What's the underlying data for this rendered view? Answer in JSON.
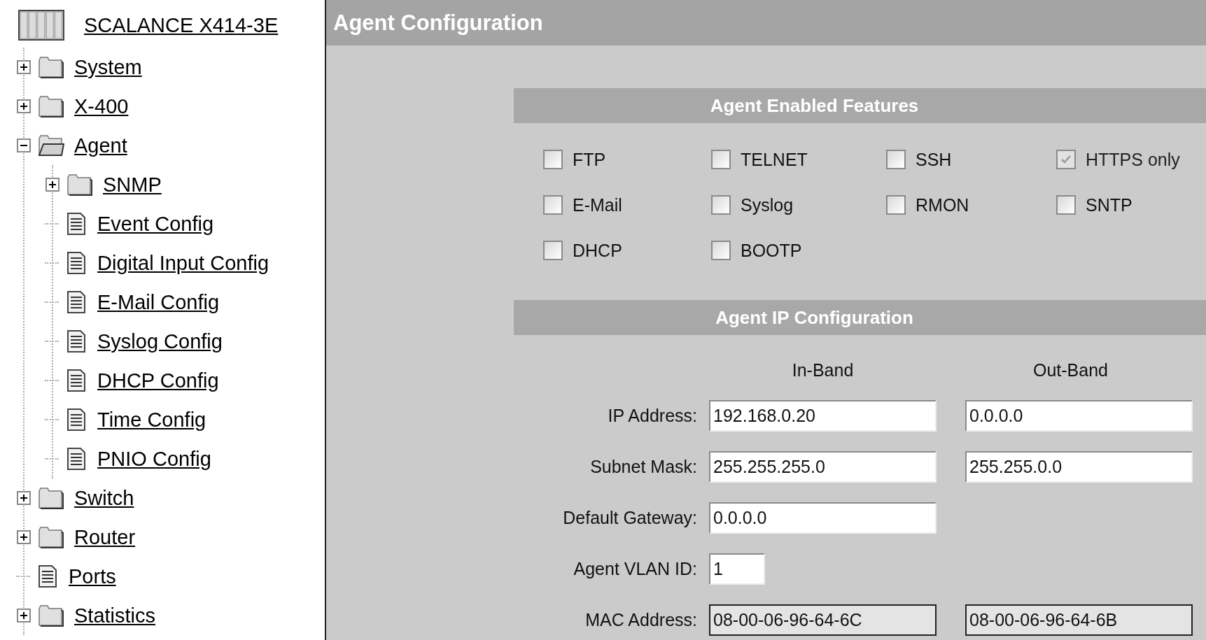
{
  "tree": {
    "root": {
      "label": "SCALANCE X414-3E",
      "kind": "device"
    },
    "items": [
      {
        "label": "System",
        "kind": "folder",
        "expanded": false
      },
      {
        "label": "X-400",
        "kind": "folder",
        "expanded": false
      },
      {
        "label": "Agent",
        "kind": "folder",
        "expanded": true,
        "children": [
          {
            "label": "SNMP",
            "kind": "folder",
            "expanded": false
          },
          {
            "label": "Event Config",
            "kind": "page"
          },
          {
            "label": "Digital Input Config",
            "kind": "page"
          },
          {
            "label": "E-Mail Config",
            "kind": "page"
          },
          {
            "label": "Syslog Config",
            "kind": "page"
          },
          {
            "label": "DHCP Config",
            "kind": "page"
          },
          {
            "label": "Time Config",
            "kind": "page"
          },
          {
            "label": "PNIO Config",
            "kind": "page"
          }
        ]
      },
      {
        "label": "Switch",
        "kind": "folder",
        "expanded": false
      },
      {
        "label": "Router",
        "kind": "folder",
        "expanded": false
      },
      {
        "label": "Ports",
        "kind": "page"
      },
      {
        "label": "Statistics",
        "kind": "folder",
        "expanded": false
      }
    ]
  },
  "page": {
    "title": "Agent Configuration"
  },
  "features": {
    "title": "Agent Enabled Features",
    "items": [
      {
        "label": "FTP",
        "checked": false,
        "disabled": false
      },
      {
        "label": "TELNET",
        "checked": false,
        "disabled": false
      },
      {
        "label": "SSH",
        "checked": false,
        "disabled": false
      },
      {
        "label": "HTTPS only",
        "checked": true,
        "disabled": true
      },
      {
        "label": "E-Mail",
        "checked": false,
        "disabled": false
      },
      {
        "label": "Syslog",
        "checked": false,
        "disabled": false
      },
      {
        "label": "RMON",
        "checked": false,
        "disabled": false
      },
      {
        "label": "SNTP",
        "checked": false,
        "disabled": false
      },
      {
        "label": "DHCP",
        "checked": false,
        "disabled": false
      },
      {
        "label": "BOOTP",
        "checked": false,
        "disabled": false
      }
    ]
  },
  "ip": {
    "title": "Agent IP Configuration",
    "columns": [
      "In-Band",
      "Out-Band"
    ],
    "rows": [
      {
        "label": "IP Address:",
        "fields": [
          {
            "value": "192.168.0.20",
            "kind": "text"
          },
          {
            "value": "0.0.0.0",
            "kind": "text"
          }
        ]
      },
      {
        "label": "Subnet Mask:",
        "fields": [
          {
            "value": "255.255.255.0",
            "kind": "text"
          },
          {
            "value": "255.255.0.0",
            "kind": "text"
          }
        ]
      },
      {
        "label": "Default Gateway:",
        "fields": [
          {
            "value": "0.0.0.0",
            "kind": "text"
          }
        ]
      },
      {
        "label": "Agent VLAN ID:",
        "fields": [
          {
            "value": "1",
            "kind": "short"
          }
        ]
      },
      {
        "label": "MAC Address:",
        "fields": [
          {
            "value": "08-00-06-96-64-6C",
            "kind": "readonly"
          },
          {
            "value": "08-00-06-96-64-6B",
            "kind": "readonly"
          }
        ]
      }
    ]
  }
}
